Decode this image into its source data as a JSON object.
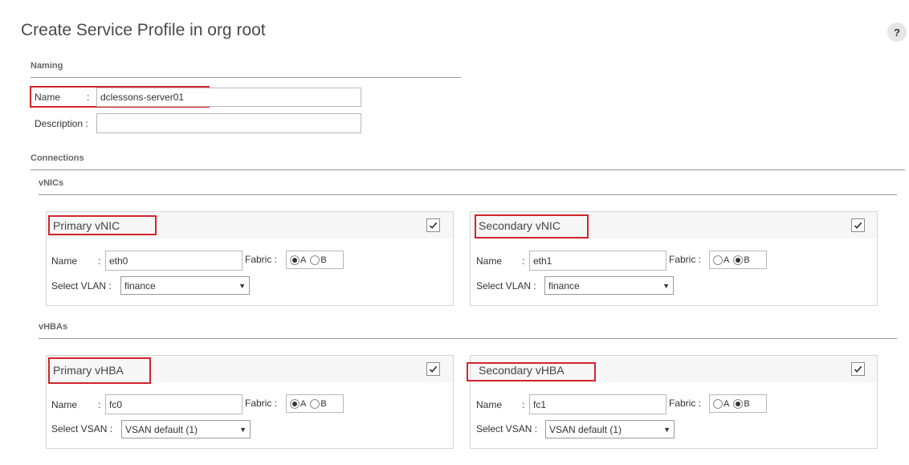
{
  "page": {
    "title": "Create Service Profile in org root",
    "help_label": "?"
  },
  "naming": {
    "section_label": "Naming",
    "name_label": "Name",
    "name_colon": ":",
    "name_value": "dclessons-server01",
    "description_label": "Description :",
    "description_value": ""
  },
  "connections": {
    "section_label": "Connections",
    "vnics": {
      "section_label": "vNICs",
      "primary": {
        "title": "Primary vNIC",
        "checked": true,
        "name_label": "Name",
        "name_colon": ":",
        "name_value": "eth0",
        "fabric_label": "Fabric :",
        "fabric_options": [
          "A",
          "B"
        ],
        "fabric_selected": "A",
        "select_label": "Select VLAN :",
        "select_value": "finance"
      },
      "secondary": {
        "title": "Secondary vNIC",
        "checked": true,
        "name_label": "Name",
        "name_colon": ":",
        "name_value": "eth1",
        "fabric_label": "Fabric :",
        "fabric_options": [
          "A",
          "B"
        ],
        "fabric_selected": "B",
        "select_label": "Select VLAN :",
        "select_value": "finance"
      }
    },
    "vhbas": {
      "section_label": "vHBAs",
      "primary": {
        "title": "Primary vHBA",
        "checked": true,
        "name_label": "Name",
        "name_colon": ":",
        "name_value": "fc0",
        "fabric_label": "Fabric :",
        "fabric_options": [
          "A",
          "B"
        ],
        "fabric_selected": "A",
        "select_label": "Select VSAN :",
        "select_value": "VSAN default (1)"
      },
      "secondary": {
        "title": "Secondary vHBA",
        "checked": true,
        "name_label": "Name",
        "name_colon": ":",
        "name_value": "fc1",
        "fabric_label": "Fabric :",
        "fabric_options": [
          "A",
          "B"
        ],
        "fabric_selected": "B",
        "select_label": "Select VSAN :",
        "select_value": "VSAN default (1)"
      }
    }
  },
  "colors": {
    "highlight": "#d0262d",
    "rule": "#999999",
    "panel_header": "#f7f7f7"
  },
  "icons": {
    "checkbox": "checkmark-icon",
    "dropdown": "caret-down-icon",
    "help": "question-icon"
  }
}
